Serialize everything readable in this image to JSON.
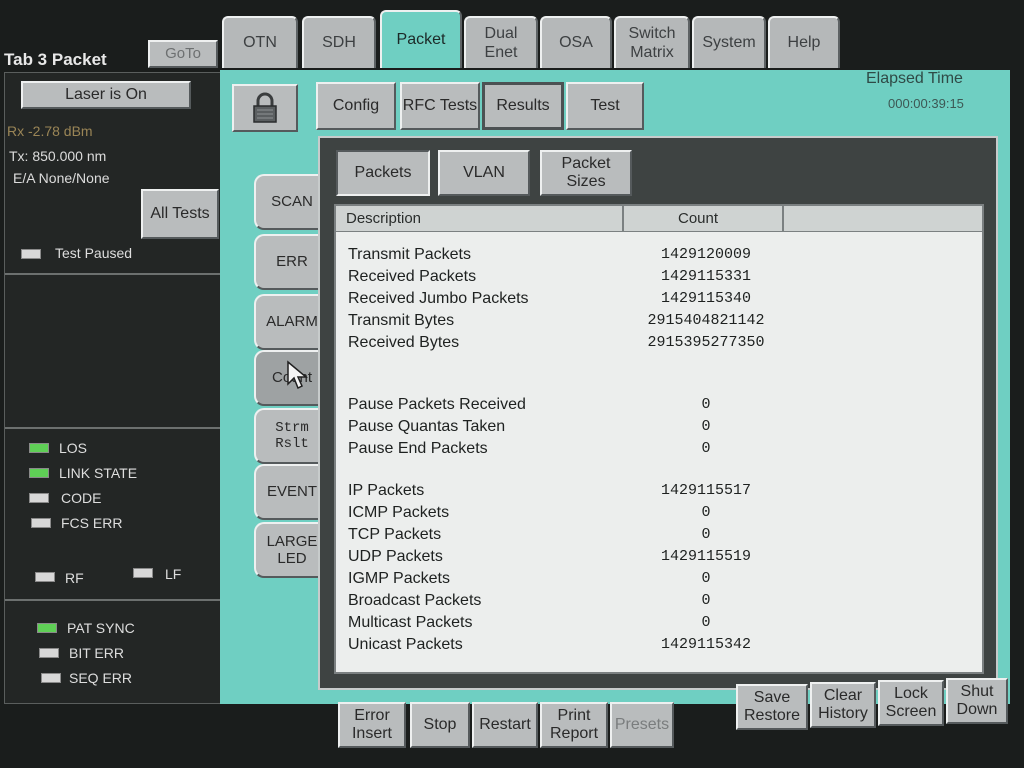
{
  "header": {
    "tab_name": "Tab 3 Packet",
    "goto_label": "GoTo",
    "tabs": [
      {
        "label": "OTN"
      },
      {
        "label": "SDH"
      },
      {
        "label": "Packet"
      },
      {
        "label": "Dual Enet"
      },
      {
        "label": "OSA"
      },
      {
        "label": "Switch Matrix"
      },
      {
        "label": "System"
      },
      {
        "label": "Help"
      }
    ],
    "active_tab": "Packet"
  },
  "status": {
    "laser_button": "Laser is On",
    "rx": "Rx -2.78 dBm",
    "tx": "Tx: 850.000 nm",
    "ea": "E/A None/None",
    "all_tests_button": "All Tests",
    "test_state": "Test Paused",
    "leds_group1": [
      {
        "label": "LOS",
        "color": "#5fcf56"
      },
      {
        "label": "LINK STATE",
        "color": "#5fcf56"
      },
      {
        "label": "CODE",
        "color": "#d8d8d8"
      },
      {
        "label": "FCS ERR",
        "color": "#d8d8d8"
      }
    ],
    "leds_rf_lf": [
      {
        "label": "RF",
        "color": "#d8d8d8"
      },
      {
        "label": "LF",
        "color": "#d8d8d8"
      }
    ],
    "leds_group2": [
      {
        "label": "PAT SYNC",
        "color": "#5fcf56"
      },
      {
        "label": "BIT ERR",
        "color": "#d8d8d8"
      },
      {
        "label": "SEQ ERR",
        "color": "#d8d8d8"
      }
    ]
  },
  "toolbar": {
    "lock_icon": "padlock-icon",
    "subtabs": [
      {
        "label": "Config"
      },
      {
        "label": "RFC Tests"
      },
      {
        "label": "Results"
      },
      {
        "label": "Test"
      }
    ],
    "active_subtab": "Results",
    "elapsed_label": "Elapsed Time",
    "elapsed_value": "000:00:39:15"
  },
  "side_tabs": [
    {
      "label": "SCAN"
    },
    {
      "label": "ERR"
    },
    {
      "label": "ALARM"
    },
    {
      "label": "Count"
    },
    {
      "label": "Strm Rslt"
    },
    {
      "label": "EVENT"
    },
    {
      "label": "LARGE LED"
    }
  ],
  "active_side_tab": "Count",
  "content_tabs": [
    {
      "label": "Packets"
    },
    {
      "label": "VLAN"
    },
    {
      "label": "Packet Sizes"
    }
  ],
  "active_content_tab": "Packets",
  "table": {
    "headers": [
      "Description",
      "Count"
    ],
    "rows": [
      {
        "description": "Transmit Packets",
        "count": "1429120009"
      },
      {
        "description": "Received Packets",
        "count": "1429115331"
      },
      {
        "description": "Received Jumbo Packets",
        "count": "1429115340"
      },
      {
        "description": "Transmit Bytes",
        "count": "2915404821142"
      },
      {
        "description": "Received Bytes",
        "count": "2915395277350"
      },
      {
        "description": "Pause Packets Received",
        "count": "0"
      },
      {
        "description": "Pause Quantas Taken",
        "count": "0"
      },
      {
        "description": "Pause End Packets",
        "count": "0"
      },
      {
        "description": "IP Packets",
        "count": "1429115517"
      },
      {
        "description": "ICMP Packets",
        "count": "0"
      },
      {
        "description": "TCP Packets",
        "count": "0"
      },
      {
        "description": "UDP Packets",
        "count": "1429115519"
      },
      {
        "description": "IGMP Packets",
        "count": "0"
      },
      {
        "description": "Broadcast Packets",
        "count": "0"
      },
      {
        "description": "Multicast Packets",
        "count": "0"
      },
      {
        "description": "Unicast Packets",
        "count": "1429115342"
      }
    ]
  },
  "bottom_bar": {
    "left_buttons": [
      {
        "label": "Error Insert"
      },
      {
        "label": "Stop"
      },
      {
        "label": "Restart"
      },
      {
        "label": "Print Report"
      },
      {
        "label": "Presets"
      }
    ],
    "right_buttons": [
      {
        "label": "Save Restore"
      },
      {
        "label": "Clear History"
      },
      {
        "label": "Lock Screen"
      },
      {
        "label": "Shut Down"
      }
    ]
  }
}
